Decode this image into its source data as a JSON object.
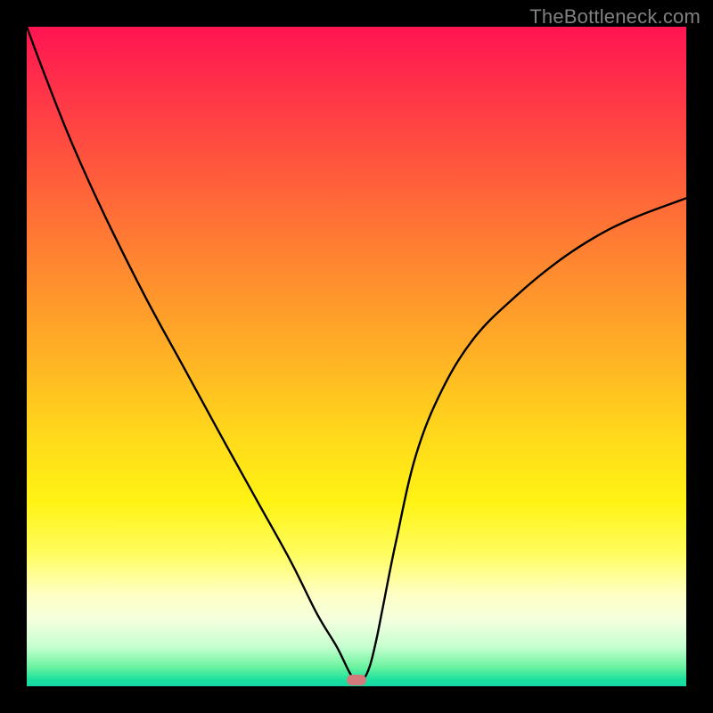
{
  "watermark": "TheBottleneck.com",
  "chart_data": {
    "type": "line",
    "title": "",
    "xlabel": "",
    "ylabel": "",
    "xlim": [
      0,
      100
    ],
    "ylim": [
      0,
      100
    ],
    "x": [
      0,
      3,
      7,
      12,
      18,
      24,
      30,
      35,
      40,
      44,
      47,
      49,
      50,
      51,
      52,
      53,
      54,
      56,
      59,
      63,
      68,
      74,
      80,
      86,
      92,
      100
    ],
    "values": [
      100,
      92,
      82,
      71,
      59,
      48,
      37,
      28,
      19,
      11,
      6,
      2,
      1,
      1,
      3,
      7,
      12,
      22,
      35,
      45,
      53,
      59,
      64,
      68,
      71,
      74
    ],
    "marker": {
      "x": 50,
      "y": 1
    },
    "gradient_stops": [
      {
        "pos": 0,
        "color": "#ff1452"
      },
      {
        "pos": 8,
        "color": "#ff2e4a"
      },
      {
        "pos": 22,
        "color": "#ff5a3c"
      },
      {
        "pos": 36,
        "color": "#ff8730"
      },
      {
        "pos": 50,
        "color": "#ffb225"
      },
      {
        "pos": 62,
        "color": "#ffd91b"
      },
      {
        "pos": 72,
        "color": "#fff314"
      },
      {
        "pos": 80,
        "color": "#fffd60"
      },
      {
        "pos": 86,
        "color": "#ffffc4"
      },
      {
        "pos": 90,
        "color": "#f4ffde"
      },
      {
        "pos": 94,
        "color": "#c6ffd0"
      },
      {
        "pos": 97,
        "color": "#6ef3a0"
      },
      {
        "pos": 99,
        "color": "#1de19e"
      },
      {
        "pos": 100,
        "color": "#15d9a4"
      }
    ]
  }
}
